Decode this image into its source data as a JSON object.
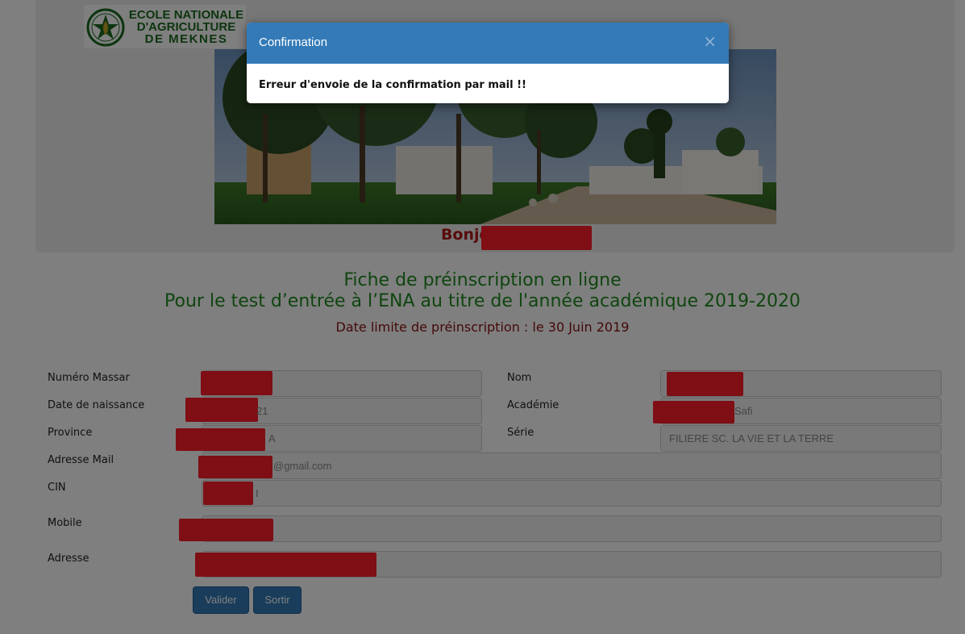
{
  "logo": {
    "line1": "ECOLE NATIONALE",
    "line2": "D'AGRICULTURE",
    "line3": "DE MEKNES"
  },
  "greeting": "Bonjour E",
  "headings": {
    "title1": "Fiche de préinscription en ligne",
    "title2": "Pour le test d’entrée à l’ENA au titre de l'année académique 2019-2020",
    "deadline": "Date limite de préinscription : le 30 Juin 2019"
  },
  "form": {
    "massar_label": "Numéro Massar",
    "nom_label": "Nom",
    "naissance_label": "Date de naissance",
    "naissance_value": "21",
    "academie_label": "Académie",
    "academie_value": "Safi",
    "province_label": "Province",
    "province_value": "A",
    "serie_label": "Série",
    "serie_value": "FILIERE SC. LA VIE ET LA TERRE",
    "mail_label": "Adresse Mail",
    "mail_value": "@gmail.com",
    "cin_label": "CIN",
    "cin_value": "I",
    "mobile_label": "Mobile",
    "adresse_label": "Adresse"
  },
  "buttons": {
    "valider": "Valider",
    "sortir": "Sortir"
  },
  "modal": {
    "title": "Confirmation",
    "close": "×",
    "message": "Erreur d'envoie de la confirmation par mail !!"
  },
  "colors": {
    "primary": "#337ab7",
    "heading_green": "#1f8a1f",
    "heading_red": "#b01818",
    "redaction": "#ff1c2a"
  }
}
